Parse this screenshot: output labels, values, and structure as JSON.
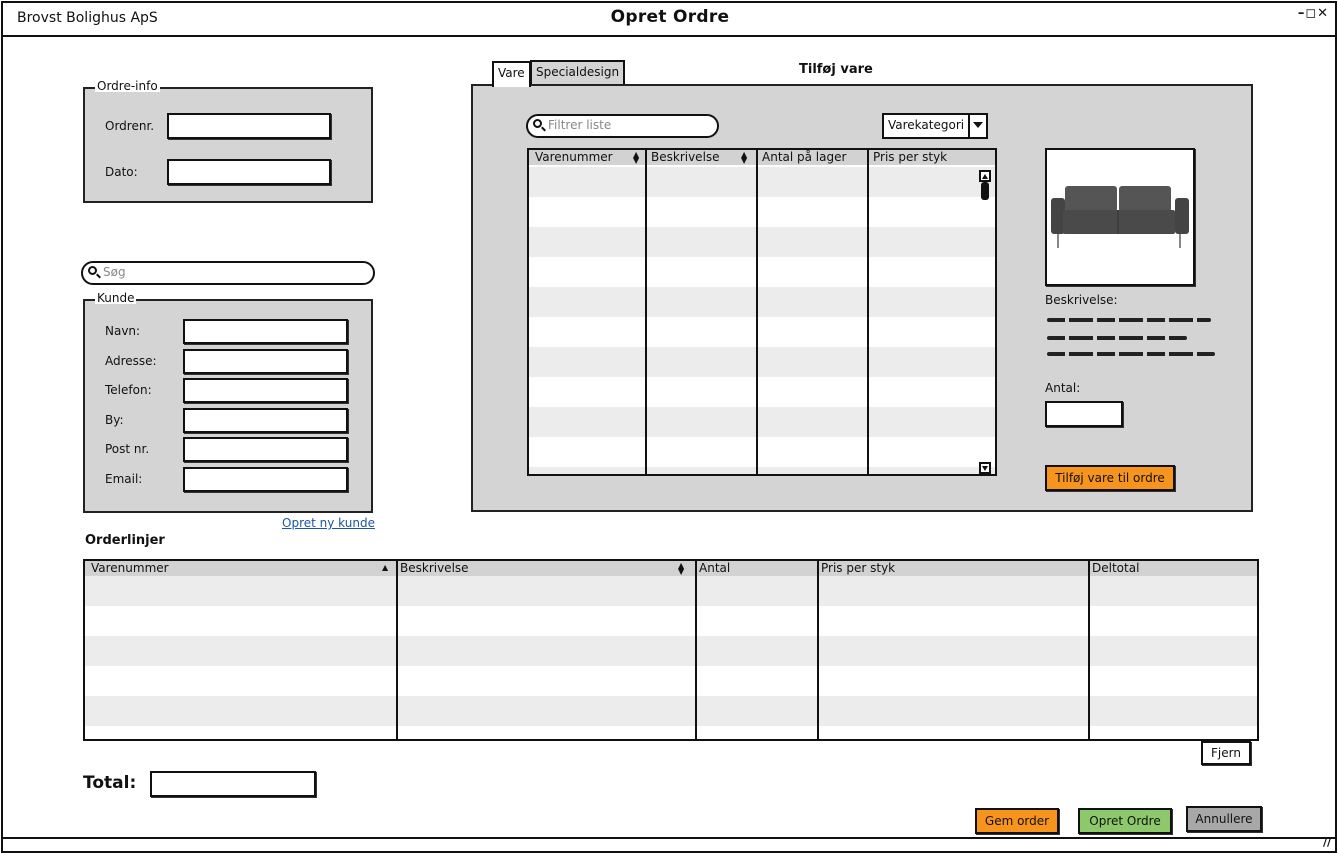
{
  "window": {
    "app_name": "Brovst Bolighus ApS",
    "title": "Opret Ordre",
    "controls": "–◻✕"
  },
  "order_info": {
    "legend": "Ordre-info",
    "order_no_label": "Ordrenr.",
    "order_no_value": "",
    "date_label": "Dato:",
    "date_value": ""
  },
  "customer_search": {
    "placeholder": "Søg"
  },
  "customer": {
    "legend": "Kunde",
    "fields": [
      {
        "label": "Navn:",
        "value": ""
      },
      {
        "label": "Adresse:",
        "value": ""
      },
      {
        "label": "Telefon:",
        "value": ""
      },
      {
        "label": "By:",
        "value": ""
      },
      {
        "label": "Post nr.",
        "value": ""
      },
      {
        "label": "Email:",
        "value": ""
      }
    ],
    "new_customer_link": "Opret ny kunde"
  },
  "tabs": [
    {
      "label": "Vare",
      "active": true
    },
    {
      "label": "Specialdesign",
      "active": false
    }
  ],
  "add_item": {
    "title": "Tilføj vare",
    "filter_placeholder": "Filtrer liste",
    "category_select": "Varekategori",
    "columns": [
      "Varenummer",
      "Beskrivelse",
      "Antal på lager",
      "Pris per styk"
    ],
    "product_image": "sofa-image",
    "description_label": "Beskrivelse:",
    "quantity_label": "Antal:",
    "quantity_value": "",
    "add_button": "Tilføj vare til ordre"
  },
  "order_lines": {
    "title": "Orderlinjer",
    "columns": [
      "Varenummer",
      "Beskrivelse",
      "Antal",
      "Pris per styk",
      "Deltotal"
    ],
    "remove_button": "Fjern"
  },
  "total": {
    "label": "Total:",
    "value": ""
  },
  "actions": {
    "save": "Gem order",
    "create": "Opret Ordre",
    "cancel": "Annullere"
  },
  "colors": {
    "panel": "#d4d4d4",
    "orange": "#f7941d",
    "green": "#8dc96b",
    "gray": "#a8a8a8",
    "link": "#1a55a8"
  }
}
